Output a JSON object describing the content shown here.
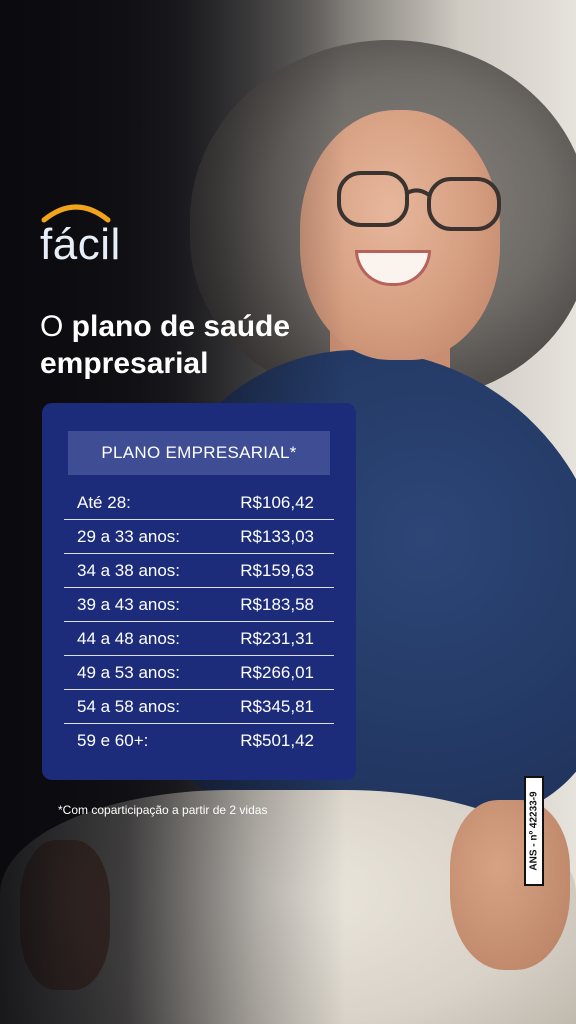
{
  "brand": {
    "name": "fácil",
    "arc_color": "#f2a51a"
  },
  "headline": {
    "prefix": "O ",
    "bold_1": "plano de saúde",
    "bold_2": "empresarial"
  },
  "table": {
    "header": "PLANO EMPRESARIAL*",
    "rows": [
      {
        "label": "Até 28:",
        "price": "R$106,42"
      },
      {
        "label": "29 a 33 anos:",
        "price": "R$133,03"
      },
      {
        "label": "34 a 38 anos:",
        "price": "R$159,63"
      },
      {
        "label": "39 a 43 anos:",
        "price": "R$183,58"
      },
      {
        "label": "44 a 48 anos:",
        "price": "R$231,31"
      },
      {
        "label": "49 a 53 anos:",
        "price": "R$266,01"
      },
      {
        "label": "54 a 58 anos:",
        "price": "R$345,81"
      },
      {
        "label": "59 e 60+:",
        "price": "R$501,42"
      }
    ]
  },
  "footnote": "*Com coparticipação a partir de 2 vidas",
  "ans_label": "ANS - nº 42233-9",
  "colors": {
    "card": "#1c2c7a",
    "card_header": "#3f4d94"
  }
}
